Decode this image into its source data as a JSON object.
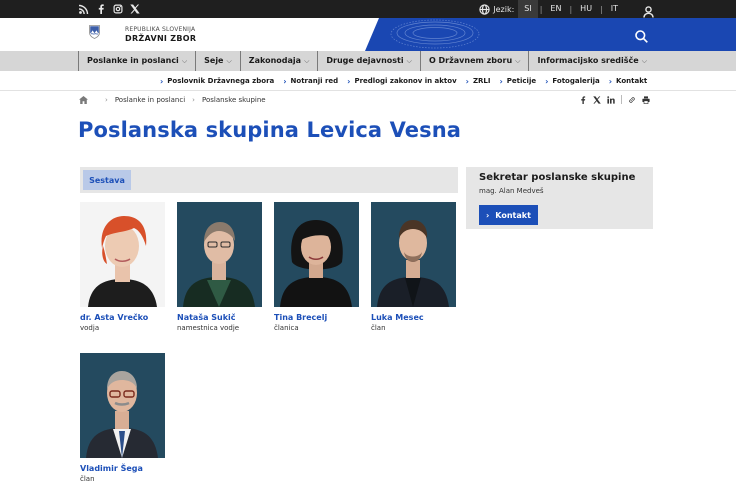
{
  "topbar": {
    "language_label": "Jezik:",
    "languages": [
      "SI",
      "EN",
      "HU",
      "IT"
    ],
    "social_icons": [
      "rss-icon",
      "facebook-icon",
      "instagram-icon",
      "x-icon"
    ]
  },
  "header": {
    "brand_line1": "REPUBLIKA SLOVENIJA",
    "brand_line2": "DRŽAVNI ZBOR"
  },
  "main_nav": [
    "Poslanke in poslanci",
    "Seje",
    "Zakonodaja",
    "Druge dejavnosti",
    "O Državnem zboru",
    "Informacijsko središče"
  ],
  "sub_nav": [
    "Poslovnik Državnega zbora",
    "Notranji red",
    "Predlogi zakonov in aktov",
    "ZRLI",
    "Peticije",
    "Fotogalerija",
    "Kontakt"
  ],
  "breadcrumb": [
    "Poslanke in poslanci",
    "Poslanske skupine"
  ],
  "page": {
    "title": "Poslanska skupina Levica Vesna",
    "tab": "Sestava"
  },
  "secretary": {
    "heading": "Sekretar poslanske skupine",
    "name": "mag. Alan Medveš",
    "button": "Kontakt"
  },
  "members": [
    {
      "name": "dr. Asta Vrečko",
      "role": "vodja"
    },
    {
      "name": "Nataša Sukič",
      "role": "namestnica vodje"
    },
    {
      "name": "Tina Brecelj",
      "role": "članica"
    },
    {
      "name": "Luka Mesec",
      "role": "član"
    },
    {
      "name": "Vladimir Šega",
      "role": "član"
    }
  ],
  "colors": {
    "accent": "#1c4fb8",
    "topbar": "#1f1f1f",
    "nav_bg": "#d6d6d6",
    "photo_bg": "#23475e"
  }
}
